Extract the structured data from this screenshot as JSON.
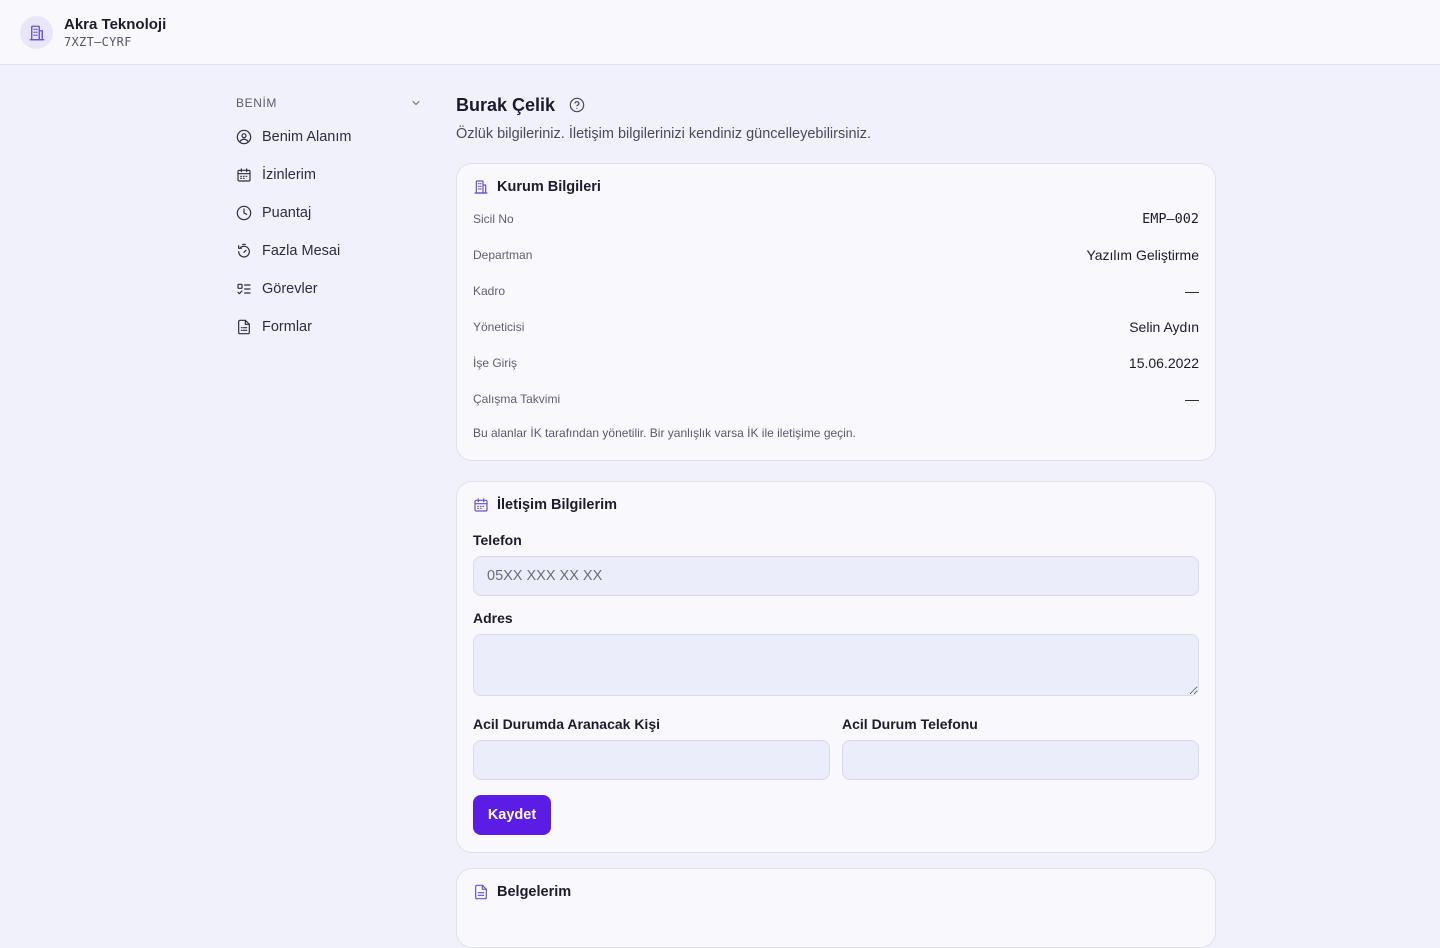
{
  "org": {
    "name": "Akra Teknoloji",
    "code": "7XZT–CYRF",
    "icon": "building-icon"
  },
  "sidebar": {
    "section_label": "BENİM",
    "items": [
      {
        "label": "Benim Alanım",
        "icon": "user-circle-icon"
      },
      {
        "label": "İzinlerim",
        "icon": "calendar-icon"
      },
      {
        "label": "Puantaj",
        "icon": "clock-icon"
      },
      {
        "label": "Fazla Mesai",
        "icon": "timer-icon"
      },
      {
        "label": "Görevler",
        "icon": "task-list-icon"
      },
      {
        "label": "Formlar",
        "icon": "document-icon"
      }
    ]
  },
  "page": {
    "title": "Burak Çelik",
    "subtitle": "Özlük bilgileriniz. İletişim bilgilerinizi kendiniz güncelleyebilirsiniz."
  },
  "org_info": {
    "title": "Kurum Bilgileri",
    "rows": [
      {
        "label": "Sicil No",
        "value": "EMP–002"
      },
      {
        "label": "Departman",
        "value": "Yazılım Geliştirme"
      },
      {
        "label": "Kadro",
        "value": "—"
      },
      {
        "label": "Yöneticisi",
        "value": "Selin Aydın"
      },
      {
        "label": "İşe Giriş",
        "value": "15.06.2022"
      },
      {
        "label": "Çalışma Takvimi",
        "value": "—"
      }
    ],
    "note": "Bu alanlar İK tarafından yönetilir. Bir yanlışlık varsa İK ile iletişime geçin."
  },
  "contact": {
    "title": "İletişim Bilgilerim",
    "phone_label": "Telefon",
    "phone_placeholder": "05XX XXX XX XX",
    "phone_value": "",
    "address_label": "Adres",
    "address_value": "",
    "emergency_person_label": "Acil Durumda Aranacak Kişi",
    "emergency_person_value": "",
    "emergency_phone_label": "Acil Durum Telefonu",
    "emergency_phone_value": "",
    "save_label": "Kaydet"
  },
  "documents": {
    "title": "Belgelerim"
  },
  "colors": {
    "accent": "#5b1de6",
    "icon_accent": "#6a4fd8",
    "background": "#f1f1fb",
    "card": "#f8f8fd"
  }
}
